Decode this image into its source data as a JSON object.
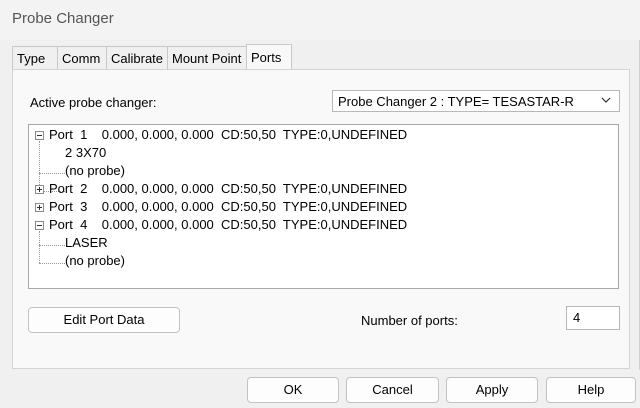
{
  "window": {
    "title": "Probe Changer"
  },
  "tabs": [
    {
      "label": "Type"
    },
    {
      "label": "Comm"
    },
    {
      "label": "Calibrate"
    },
    {
      "label": "Mount Point"
    },
    {
      "label": "Ports"
    }
  ],
  "active_tab": "Ports",
  "active_changer": {
    "label": "Active probe changer:",
    "value": "Probe Changer 2 : TYPE= TESASTAR-R"
  },
  "tree": {
    "ports": [
      {
        "text": "Port  1    0.000, 0.000, 0.000  CD:50,50  TYPE:0,UNDEFINED",
        "expanded": true,
        "children": [
          "2 3X70",
          "(no probe)"
        ]
      },
      {
        "text": "Port  2    0.000, 0.000, 0.000  CD:50,50  TYPE:0,UNDEFINED",
        "expanded": false,
        "children": []
      },
      {
        "text": "Port  3    0.000, 0.000, 0.000  CD:50,50  TYPE:0,UNDEFINED",
        "expanded": false,
        "children": []
      },
      {
        "text": "Port  4    0.000, 0.000, 0.000  CD:50,50  TYPE:0,UNDEFINED",
        "expanded": true,
        "children": [
          "LASER",
          "(no probe)"
        ]
      }
    ]
  },
  "edit_port_button": "Edit Port Data",
  "num_ports": {
    "label": "Number of ports:",
    "value": "4"
  },
  "buttons": {
    "ok": "OK",
    "cancel": "Cancel",
    "apply": "Apply",
    "help": "Help"
  }
}
